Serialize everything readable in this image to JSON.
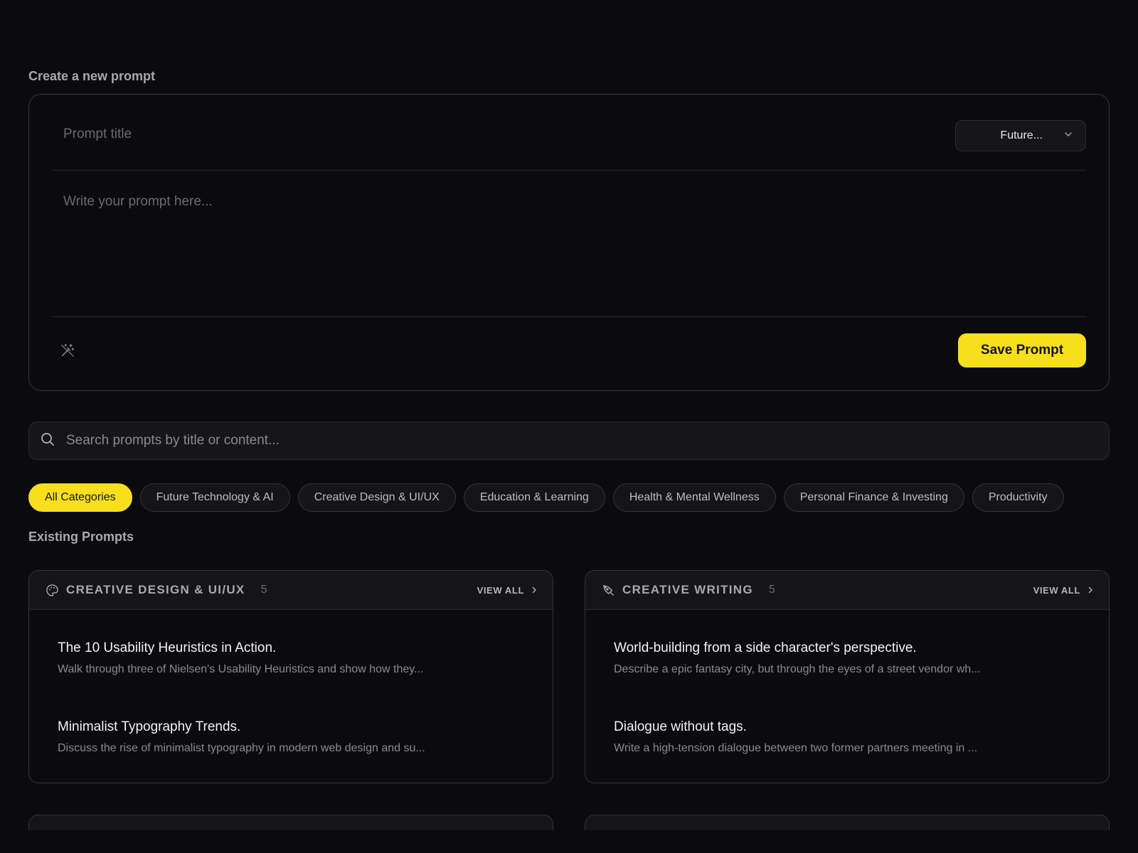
{
  "create": {
    "heading": "Create a new prompt",
    "title_placeholder": "Prompt title",
    "title_value": "",
    "category_selected": "Future...",
    "prompt_placeholder": "Write your prompt here...",
    "prompt_value": "",
    "save_label": "Save Prompt"
  },
  "search": {
    "placeholder": "Search prompts by title or content...",
    "value": ""
  },
  "categories": [
    {
      "label": "All Categories",
      "active": true
    },
    {
      "label": "Future Technology & AI",
      "active": false
    },
    {
      "label": "Creative Design & UI/UX",
      "active": false
    },
    {
      "label": "Education & Learning",
      "active": false
    },
    {
      "label": "Health & Mental Wellness",
      "active": false
    },
    {
      "label": "Personal Finance & Investing",
      "active": false
    },
    {
      "label": "Productivity",
      "active": false
    }
  ],
  "existing": {
    "heading": "Existing Prompts",
    "groups": [
      {
        "name": "CREATIVE DESIGN & UI/UX",
        "count": "5",
        "icon": "palette-icon",
        "view_all": "VIEW ALL",
        "prompts": [
          {
            "title": "The 10 Usability Heuristics in Action.",
            "desc": "Walk through three of Nielsen's Usability Heuristics and show how they..."
          },
          {
            "title": "Minimalist Typography Trends.",
            "desc": "Discuss the rise of minimalist typography in modern web design and su..."
          }
        ]
      },
      {
        "name": "CREATIVE WRITING",
        "count": "5",
        "icon": "pen-nib-icon",
        "view_all": "VIEW ALL",
        "prompts": [
          {
            "title": "World-building from a side character's perspective.",
            "desc": "Describe a epic fantasy city, but through the eyes of a street vendor wh..."
          },
          {
            "title": "Dialogue without tags.",
            "desc": "Write a high-tension dialogue between two former partners meeting in ..."
          }
        ]
      }
    ]
  },
  "colors": {
    "background": "#0b0b0d",
    "accent": "#f7df1e",
    "card_border": "#34343a",
    "surface": "#151517"
  }
}
